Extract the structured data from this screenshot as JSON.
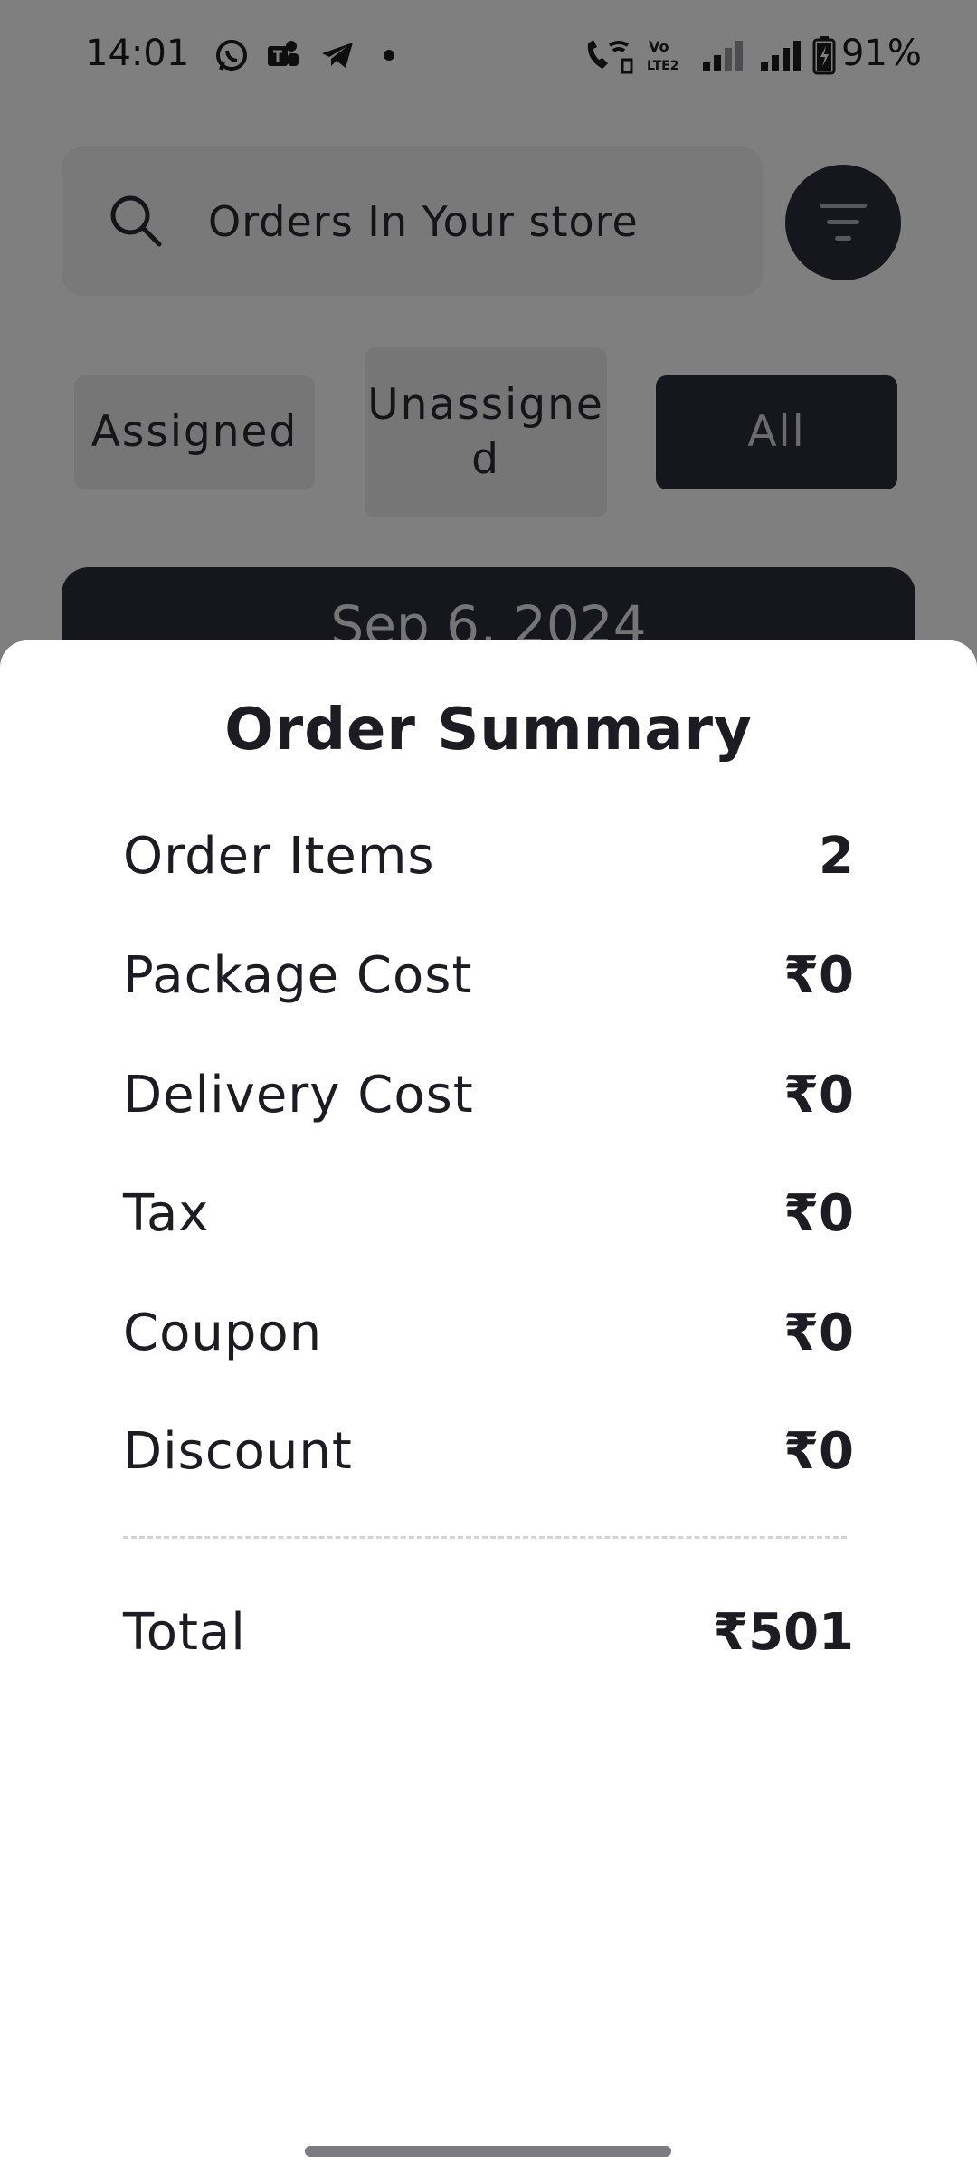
{
  "status_bar": {
    "time": "14:01",
    "battery_percent": "91%",
    "notification_icons": [
      "whatsapp-icon",
      "teams-icon",
      "telegram-icon",
      "dot-icon"
    ],
    "system_icons": [
      "wifi-calling-icon",
      "volte-icon",
      "signal-weak-icon",
      "signal-strong-icon",
      "battery-charging-icon"
    ]
  },
  "search": {
    "placeholder": "Orders In Your store",
    "icon": "search-icon"
  },
  "filter_button": {
    "icon": "filter-icon"
  },
  "tabs": [
    {
      "label": "Assigned",
      "selected": false
    },
    {
      "label": "Unassigne d",
      "selected": false
    },
    {
      "label": "All",
      "selected": true
    }
  ],
  "date_header": "Sep 6, 2024",
  "order_summary": {
    "title": "Order Summary",
    "rows": [
      {
        "label": "Order Items",
        "value": "2"
      },
      {
        "label": "Package Cost",
        "value": "₹0"
      },
      {
        "label": "Delivery Cost",
        "value": "₹0"
      },
      {
        "label": "Tax",
        "value": "₹0"
      },
      {
        "label": "Coupon",
        "value": "₹0"
      },
      {
        "label": "Discount",
        "value": "₹0"
      }
    ],
    "total_label": "Total",
    "total_value": "₹501"
  },
  "colors": {
    "accent_dark": "#2c2c3a",
    "tab_inactive": "#ececee",
    "text_primary": "#1c1c22",
    "scrim": "rgba(0,0,0,0.5)"
  }
}
